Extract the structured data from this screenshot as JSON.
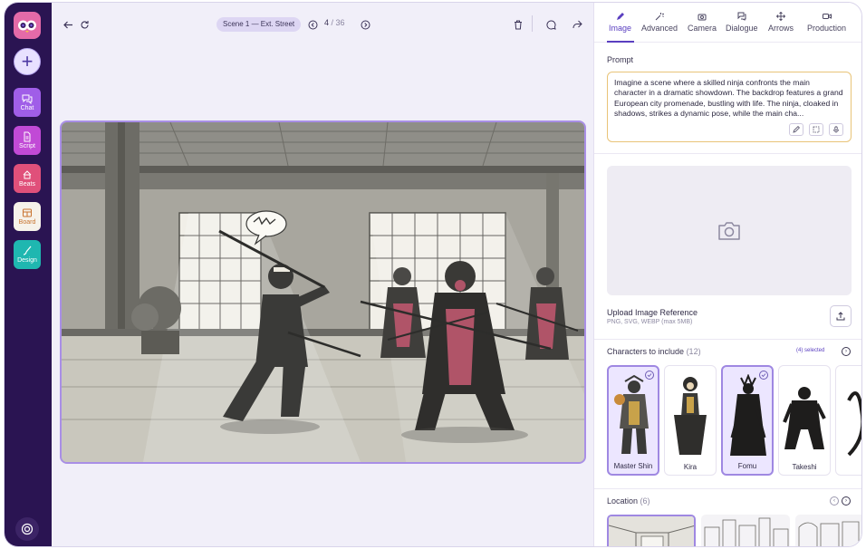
{
  "sidebar": {
    "items": [
      {
        "label": "Chat",
        "icon": "chat-bubbles-icon",
        "color": "#a05ee8"
      },
      {
        "label": "Script",
        "icon": "document-icon",
        "color": "#c14ad6"
      },
      {
        "label": "Beats",
        "icon": "drum-icon",
        "color": "#e0507a"
      },
      {
        "label": "Board",
        "icon": "storyboard-icon",
        "color": "#f6f2ea"
      },
      {
        "label": "Design",
        "icon": "brush-icon",
        "color": "#1fb7b0"
      }
    ]
  },
  "toolbar": {
    "scene_label": "Scene 1 — Ext. Street",
    "page_current": "4",
    "page_total": "/ 36"
  },
  "panel": {
    "tabs": [
      {
        "label": "Image",
        "icon": "pen-icon"
      },
      {
        "label": "Advanced",
        "icon": "sparkle-wand-icon"
      },
      {
        "label": "Camera",
        "icon": "camera-icon"
      },
      {
        "label": "Dialogue",
        "icon": "speech-bubbles-icon"
      },
      {
        "label": "Arrows",
        "icon": "move-arrows-icon"
      },
      {
        "label": "Production",
        "icon": "video-camera-icon"
      }
    ],
    "prompt": {
      "label": "Prompt",
      "text": "Imagine a scene where a skilled ninja confronts the main character in a dramatic showdown. The backdrop features a grand European city promenade, bustling with life. The ninja, cloaked in shadows, strikes a dynamic pose, while the main cha..."
    },
    "upload": {
      "title": "Upload Image Reference",
      "subtitle": "PNG, SVG, WEBP (max 5MB)"
    },
    "characters": {
      "label": "Characters to include",
      "count": "(12)",
      "selected": "(4) selected",
      "items": [
        {
          "name": "Master Shin",
          "selected": true
        },
        {
          "name": "Kira",
          "selected": false
        },
        {
          "name": "Fomu",
          "selected": true
        },
        {
          "name": "Takeshi",
          "selected": false
        }
      ]
    },
    "location": {
      "label": "Location",
      "count": "(6)"
    }
  },
  "colors": {
    "accent": "#5a3fc0",
    "sidebar_bg": "#2a1452",
    "canvas_border": "#a98fe6"
  }
}
